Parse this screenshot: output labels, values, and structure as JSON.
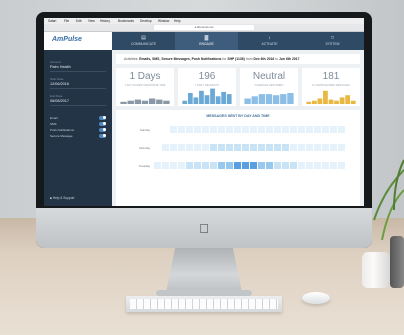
{
  "browser": {
    "menu": [
      "Safari",
      "File",
      "Edit",
      "View",
      "History",
      "Bookmarks",
      "Develop",
      "Window",
      "Help"
    ],
    "url": "a.lifemudo.net"
  },
  "app": {
    "logo_text": "AmPulse",
    "tabs": [
      {
        "label": "COMMUNICATE",
        "icon": "chat-icon"
      },
      {
        "label": "ENGAGE",
        "icon": "chart-icon"
      },
      {
        "label": "ACTIVATE",
        "icon": "pointer-icon"
      },
      {
        "label": "SYSTEM",
        "icon": "monitor-icon"
      }
    ]
  },
  "sidebar": {
    "fields": [
      {
        "label": "Account",
        "value": "Palm Health"
      },
      {
        "label": "Start Date",
        "value": "12/06/2016"
      },
      {
        "label": "End Date",
        "value": "06/08/2017"
      }
    ],
    "toggles": [
      "Email",
      "SMS",
      "Push Notifications",
      "Secure Message"
    ],
    "help": "Help & Support"
  },
  "filter": {
    "prefix": "Activities:",
    "items": "Emails, SMS, Secure Messages, Push Notifications",
    "mid": "for",
    "account": "SHP (1136)",
    "from_word": "from",
    "start": "Dec 6th 2016",
    "to_word": "to",
    "end": "Jun 6th 2017"
  },
  "cards": [
    {
      "value": "1 Days",
      "caption": "1 DAY HIGHEST RESPONSE TIME",
      "color": "#8a97a6"
    },
    {
      "value": "196",
      "caption": "7 DAILY REQUESTS",
      "color": "#6aa9d6"
    },
    {
      "value": "Neutral",
      "caption": "3 AVERAGE SENTIMENT",
      "color": "#8dbfe6"
    },
    {
      "value": "181",
      "caption": "11 UNPROCESSED MESSAGES",
      "color": "#e8b840"
    }
  ],
  "heatmap": {
    "title": "MESSAGES SENT BY DAY AND TIME",
    "rows": [
      "Sunday",
      "Monday",
      "Tuesday"
    ]
  }
}
